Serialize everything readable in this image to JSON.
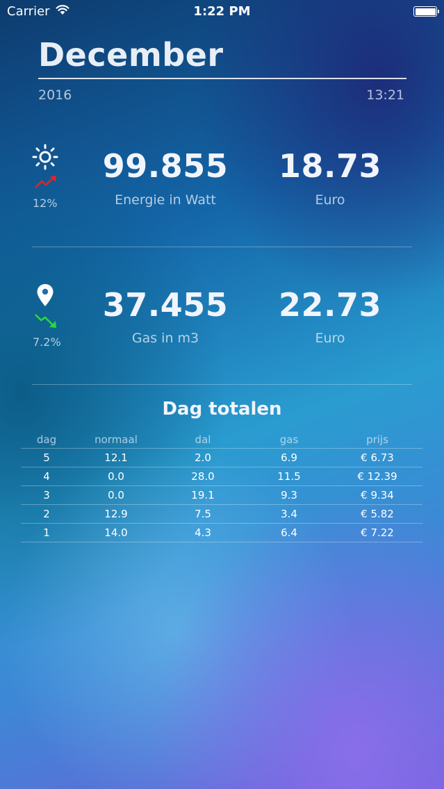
{
  "status_bar": {
    "carrier": "Carrier",
    "time": "1:22 PM"
  },
  "header": {
    "title": "December",
    "year": "2016",
    "time": "13:21"
  },
  "electricity": {
    "icon": "sun-icon",
    "trend_icon": "trend-up-icon",
    "trend_color": "#e0262b",
    "percent": "12%",
    "value": "99.855",
    "value_label": "Energie in Watt",
    "euro_value": "18.73",
    "euro_label": "Euro"
  },
  "gas": {
    "icon": "location-pin-icon",
    "trend_icon": "trend-down-icon",
    "trend_color": "#2bd83a",
    "percent": "7.2%",
    "value": "37.455",
    "value_label": "Gas in m3",
    "euro_value": "22.73",
    "euro_label": "Euro"
  },
  "daily_totals": {
    "title": "Dag totalen",
    "columns": [
      "dag",
      "normaal",
      "dal",
      "gas",
      "prijs"
    ],
    "rows": [
      [
        "5",
        "12.1",
        "2.0",
        "6.9",
        "€ 6.73"
      ],
      [
        "4",
        "0.0",
        "28.0",
        "11.5",
        "€ 12.39"
      ],
      [
        "3",
        "0.0",
        "19.1",
        "9.3",
        "€ 9.34"
      ],
      [
        "2",
        "12.9",
        "7.5",
        "3.4",
        "€ 5.82"
      ],
      [
        "1",
        "14.0",
        "4.3",
        "6.4",
        "€ 7.22"
      ]
    ]
  }
}
